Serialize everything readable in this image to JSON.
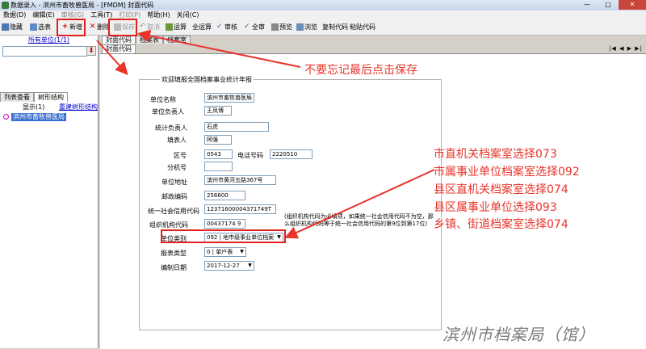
{
  "window": {
    "title": "数据录入 - 滨州市畜牧兽医局 - [FMDM] 封面代码",
    "controls": [
      "—",
      "□",
      "✕"
    ]
  },
  "menu": [
    {
      "label": "数据(D)",
      "disabled": false
    },
    {
      "label": "编辑(E)",
      "disabled": false
    },
    {
      "label": "审核(G)",
      "disabled": true
    },
    {
      "label": "工具(T)",
      "disabled": false
    },
    {
      "label": "打印(P)",
      "disabled": true
    },
    {
      "label": "帮助(H)",
      "disabled": false
    },
    {
      "label": "关闭(C)",
      "disabled": false
    }
  ],
  "toolbar": {
    "hide": "隐藏",
    "select_table": "选表",
    "new": "新增",
    "delete": "删除",
    "save": "保存",
    "cancel": "取消",
    "calculate": "运算",
    "calculate_all": "全运算",
    "audit": "审核",
    "audit_all": "全审",
    "reserved": "预览",
    "copy_code": "复制代码",
    "paste_code": "粘贴代码",
    "preview": "浏览"
  },
  "left": {
    "current_unit": "所有单位(1/1)",
    "tabs": [
      "列表查看",
      "树形结构"
    ],
    "show": "显示(1)",
    "rebuild": "重建树形结构",
    "tree_item": "滨州市畜牧兽医局"
  },
  "right_tabs": {
    "row1": [
      "封面代码",
      "档案表",
      "档案室"
    ],
    "row2": [
      "封面代码"
    ]
  },
  "form": {
    "legend": "欢迎填报全国档案事业统计年报",
    "unit_name_label": "单位名称",
    "unit_name": "滨州市畜牧兽医局",
    "unit_head_label": "单位负责人",
    "unit_head": "王凤博",
    "stat_head_label": "统计负责人",
    "stat_head": "石虎",
    "filler_label": "填表人",
    "filler": "阿强",
    "area_code_label": "区号",
    "area_code": "0543",
    "phone_label": "电话号码",
    "phone": "2220510",
    "ext_label": "分机号",
    "ext": "",
    "address_label": "单位地址",
    "address": "滨州市黄河五路367号",
    "postcode_label": "邮政编码",
    "postcode": "256600",
    "credit_code_label": "统一社会信用代码",
    "credit_code": "12371600004371749T",
    "org_code_label": "组织机构代码",
    "org_code": "00437174 9",
    "note": "(组织机构代码为必填项，如果统一社会信用代码不为空，那么组织机构代码等于统一社会信用代码的第9位到第17位)",
    "unit_type_label": "单位类别",
    "unit_type": "092 | 地市级事业单位档案",
    "report_type_label": "报表类型",
    "report_type": "0 | 单户表",
    "date_label": "编制日期",
    "date": "2017-12-27"
  },
  "annotations": {
    "save_reminder": "不要忘记最后点击保存",
    "choices": [
      "市直机关档案室选择073",
      "市属事业单位档案室选择092",
      "县区直机关档案室选择074",
      "县区属事业单位选择093",
      "乡镇、街道档案室选择074"
    ],
    "watermark": "滨州市档案局（馆）"
  },
  "nav_arrows": "|◀ ◀ ▶ ▶|",
  "colors": {
    "annotation_red": "#e8342a",
    "selection_blue": "#3a6fcf",
    "link_blue": "#0000cc"
  }
}
